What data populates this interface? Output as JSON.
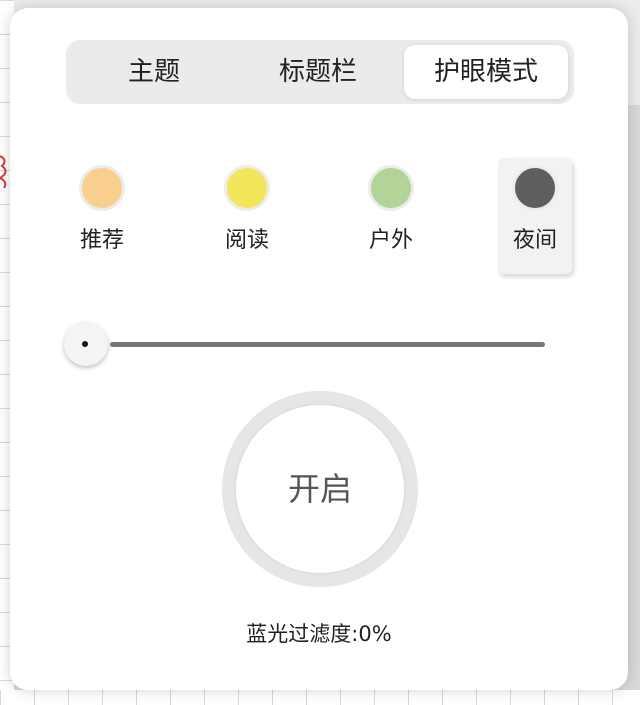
{
  "tabs": [
    {
      "label": "主题"
    },
    {
      "label": "标题栏"
    },
    {
      "label": "护眼模式",
      "active": true
    }
  ],
  "modes": [
    {
      "label": "推荐",
      "color": "#f8cf8c"
    },
    {
      "label": "阅读",
      "color": "#f4e65a"
    },
    {
      "label": "户外",
      "color": "#b2d497"
    },
    {
      "label": "夜间",
      "color": "#5f5f5f",
      "selected": true
    }
  ],
  "slider": {
    "value": 0
  },
  "power": {
    "label": "开启"
  },
  "filter": {
    "label": "蓝光过滤度:",
    "value": "0%"
  },
  "colors": {
    "panel": "#ffffff",
    "tab_bar": "#ebebeb",
    "track": "#77777c"
  }
}
